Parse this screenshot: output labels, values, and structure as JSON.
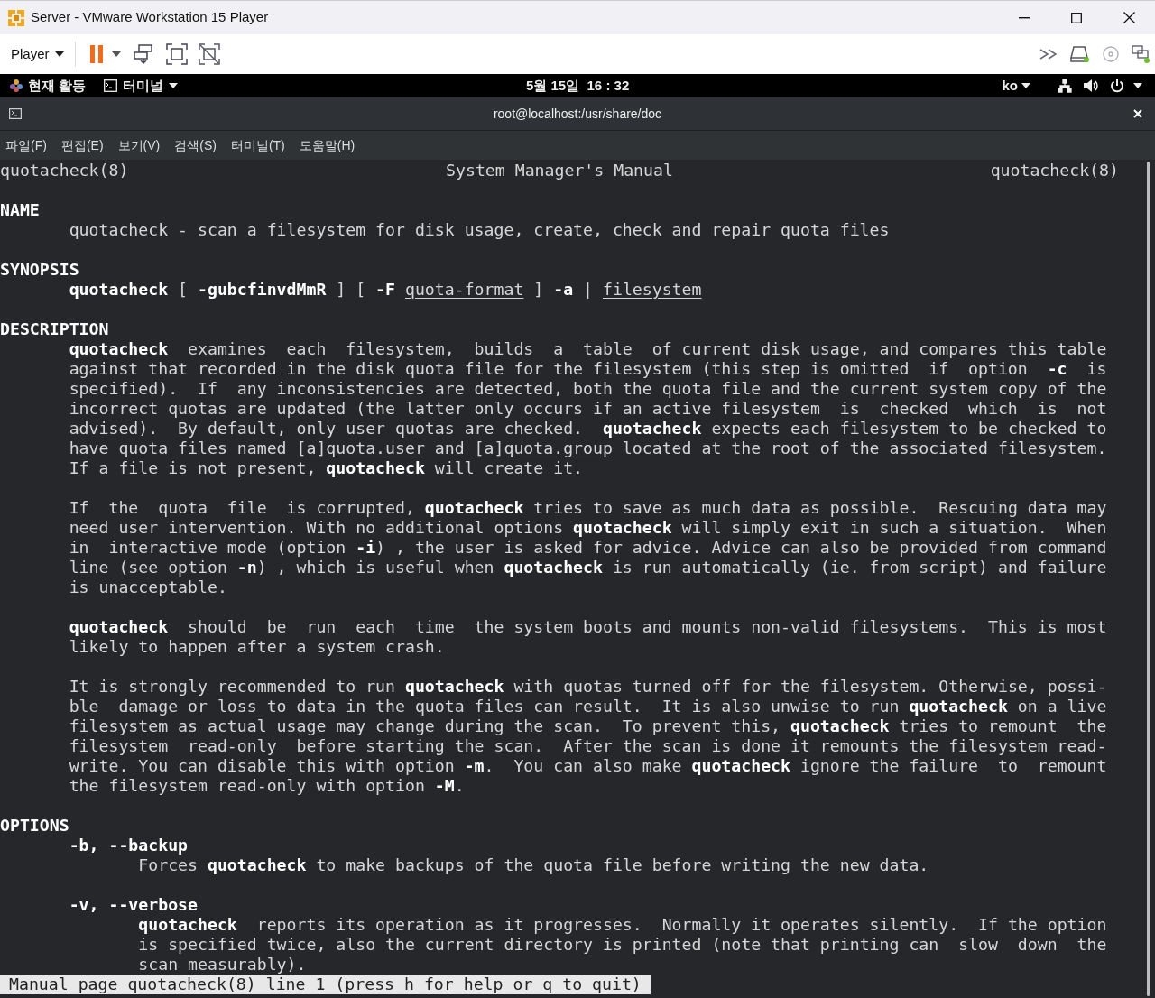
{
  "window": {
    "title": "Server - VMware Workstation 15 Player"
  },
  "toolbar": {
    "menu": "Player"
  },
  "gnome_bar": {
    "activities": "현재 활동",
    "app_menu": "터미널",
    "clock": "5월 15일  16 : 32",
    "input_method": "ko"
  },
  "terminal": {
    "title": "root@localhost:/usr/share/doc",
    "menus": [
      "파일(F)",
      "편집(E)",
      "보기(V)",
      "검색(S)",
      "터미널(T)",
      "도움말(H)"
    ],
    "man_page": {
      "header": {
        "left": "quotacheck(8)",
        "center": "System Manager's Manual",
        "right": "quotacheck(8)"
      },
      "blocks": [
        {
          "lines": [
            {
              "kind": "heading",
              "text": "NAME"
            },
            {
              "kind": "text",
              "text": "quotacheck - scan a filesystem for disk usage, create, check and repair quota files"
            }
          ]
        },
        {
          "lines": [
            {
              "kind": "heading",
              "text": "SYNOPSIS"
            },
            {
              "kind": "text",
              "text": "**quotacheck** [ **-gubcfinvdMmR** ] [ **-F** *quota-format* ] **-a** | *filesystem*"
            }
          ]
        },
        {
          "lines": [
            {
              "kind": "heading",
              "text": "DESCRIPTION"
            },
            {
              "kind": "text",
              "text": "**quotacheck**  examines  each  filesystem,  builds  a  table  of current disk usage, and compares this table"
            },
            {
              "kind": "text",
              "text": "against that recorded in the disk quota file for the filesystem (this step is omitted  if  option  **-c**  is"
            },
            {
              "kind": "text",
              "text": "specified).  If  any inconsistencies are detected, both the quota file and the current system copy of the"
            },
            {
              "kind": "text",
              "text": "incorrect quotas are updated (the latter only occurs if an active filesystem  is  checked  which  is  not"
            },
            {
              "kind": "text",
              "text": "advised).  By default, only user quotas are checked.  **quotacheck** expects each filesystem to be checked to"
            },
            {
              "kind": "text",
              "text": "have quota files named *[a]quota.user* and *[a]quota.group* located at the root of the associated filesystem."
            },
            {
              "kind": "text",
              "text": "If a file is not present, **quotacheck** will create it."
            }
          ]
        },
        {
          "lines": [
            {
              "kind": "text",
              "text": "If  the  quota  file  is corrupted, **quotacheck** tries to save as much data as possible.  Rescuing data may"
            },
            {
              "kind": "text",
              "text": "need user intervention. With no additional options **quotacheck** will simply exit in such a situation.  When"
            },
            {
              "kind": "text",
              "text": "in  interactive mode (option **-i**) , the user is asked for advice. Advice can also be provided from command"
            },
            {
              "kind": "text",
              "text": "line (see option **-n**) , which is useful when **quotacheck** is run automatically (ie. from script) and failure"
            },
            {
              "kind": "text",
              "text": "is unacceptable."
            }
          ]
        },
        {
          "lines": [
            {
              "kind": "text",
              "text": "**quotacheck**  should  be  run  each  time  the system boots and mounts non-valid filesystems.  This is most"
            },
            {
              "kind": "text",
              "text": "likely to happen after a system crash."
            }
          ]
        },
        {
          "lines": [
            {
              "kind": "text",
              "text": "It is strongly recommended to run **quotacheck** with quotas turned off for the filesystem. Otherwise, possi‐"
            },
            {
              "kind": "text",
              "text": "ble  damage or loss to data in the quota files can result.  It is also unwise to run **quotacheck** on a live"
            },
            {
              "kind": "text",
              "text": "filesystem as actual usage may change during the scan.  To prevent this, **quotacheck** tries to remount  the"
            },
            {
              "kind": "text",
              "text": "filesystem  read-only  before starting the scan.  After the scan is done it remounts the filesystem read-"
            },
            {
              "kind": "text",
              "text": "write. You can disable this with option **-m**.  You can also make **quotacheck** ignore the failure  to  remount"
            },
            {
              "kind": "text",
              "text": "the filesystem read-only with option **-M**."
            }
          ]
        },
        {
          "lines": [
            {
              "kind": "heading",
              "text": "OPTIONS"
            },
            {
              "kind": "text",
              "text": "**-b, --backup**"
            },
            {
              "kind": "sub",
              "text": "Forces **quotacheck** to make backups of the quota file before writing the new data."
            }
          ]
        },
        {
          "lines": [
            {
              "kind": "text",
              "text": "**-v, --verbose**"
            },
            {
              "kind": "sub",
              "text": "**quotacheck**  reports its operation as it progresses.  Normally it operates silently.  If the option"
            },
            {
              "kind": "sub",
              "text": "is specified twice, also the current directory is printed (note that printing can  slow  down  the"
            },
            {
              "kind": "sub",
              "text": "scan measurably)."
            }
          ]
        }
      ]
    },
    "status_line": "Manual page quotacheck(8) line 1 (press h for help or q to quit)"
  }
}
